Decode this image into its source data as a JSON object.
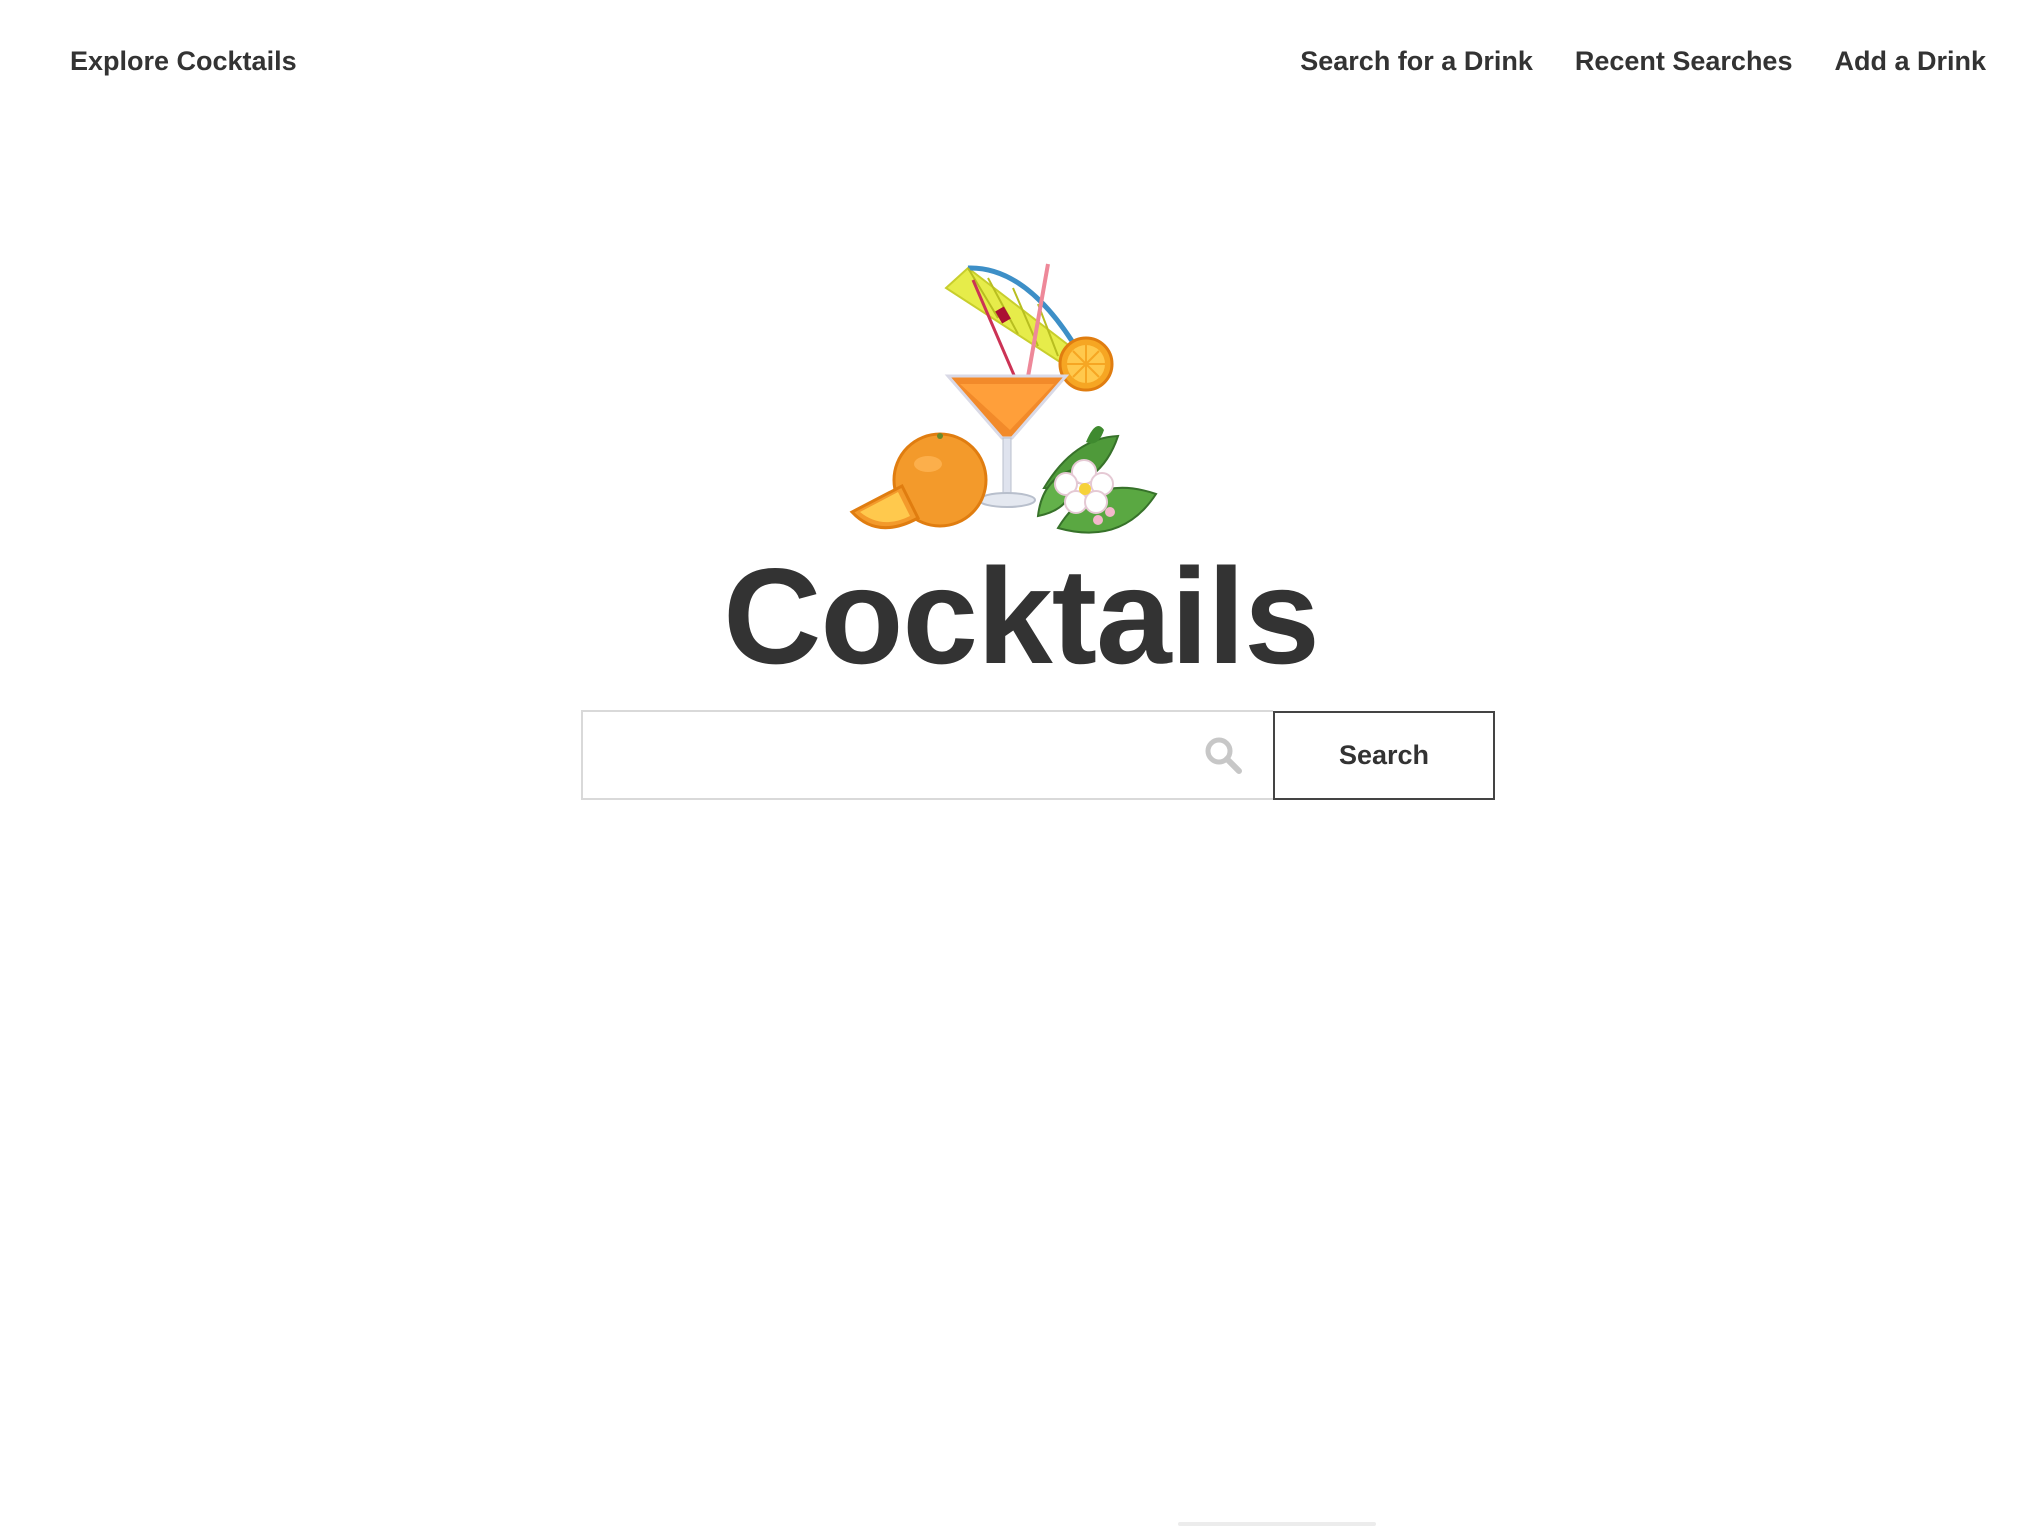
{
  "header": {
    "brand": "Explore Cocktails",
    "nav": [
      {
        "label": "Search for a Drink"
      },
      {
        "label": "Recent Searches"
      },
      {
        "label": "Add a Drink"
      }
    ]
  },
  "hero": {
    "title": "Cocktails",
    "image_name": "cocktail-illustration"
  },
  "search": {
    "value": "",
    "placeholder": "",
    "button_label": "Search"
  },
  "colors": {
    "text": "#333333",
    "border": "#d9d9d9",
    "button_border": "#444444",
    "orange": "#f39a2b",
    "leaf": "#4f9a3a",
    "umbrella": "#e6ec4a"
  }
}
